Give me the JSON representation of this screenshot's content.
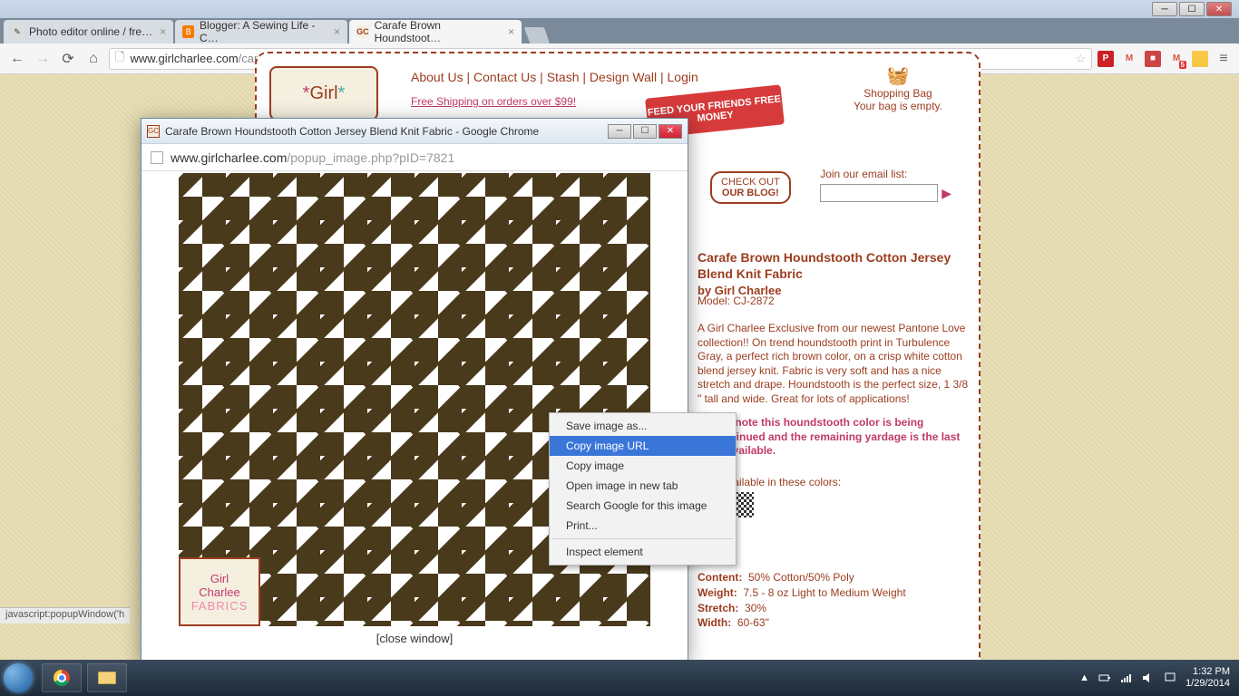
{
  "window": {
    "minimize": "─",
    "maximize": "☐",
    "close": "✕"
  },
  "tabs": [
    {
      "title": "Photo editor online / fre…"
    },
    {
      "title": "Blogger: A Sewing Life - C…"
    },
    {
      "title": "Carafe Brown Houndstoot…"
    }
  ],
  "omnibox": {
    "host": "www.girlcharlee.com",
    "path": "/carafe-brown-houndstooth-cotton-jersey-blend-knit-fabric/girl-charlee-p-7821.html?cPath=149"
  },
  "ext": {
    "pinterest": "P",
    "gmail": "M",
    "wall": "■",
    "gmail2": "M",
    "badge": "5",
    "menu": "≡"
  },
  "nav": {
    "about": "About Us",
    "contact": "Contact Us",
    "stash": "Stash",
    "design": "Design Wall",
    "login": "Login",
    "sep": " | "
  },
  "logo": "Girl",
  "shipping": "Free Shipping on orders over $99!",
  "ribbon": "FEED YOUR FRIENDS FREE MONEY",
  "bag": {
    "icon": "🧺",
    "label": "Shopping Bag",
    "empty": "Your bag is empty."
  },
  "blog": {
    "line1": "CHECK OUT",
    "line2": "OUR BLOG!"
  },
  "email": {
    "label": "Join our email list:",
    "arrow": "▶"
  },
  "product": {
    "title": "Carafe Brown Houndstooth Cotton Jersey Blend Knit Fabric",
    "by": "by Girl Charlee",
    "model": "Model: CJ-2872",
    "desc": "A Girl Charlee Exclusive from our newest Pantone Love collection!! On trend houndstooth print in Turbulence Gray, a perfect rich brown color, on a crisp white cotton blend jersey knit. Fabric is very soft and has a nice stretch and drape. Houndstooth is the perfect size, 1 3/8 \" tall and wide. Great for lots of applications!",
    "note": "Please note this houndstooth color is being discontinued and the remaining yardage is the last to be available.",
    "avail": "Also available in these colors:",
    "content_l": "Content:",
    "content_v": "50% Cotton/50% Poly",
    "weight_l": "Weight:",
    "weight_v": "7.5 - 8 oz Light to Medium Weight",
    "stretch_l": "Stretch:",
    "stretch_v": "30%",
    "width_l": "Width:",
    "width_v": "60-63\""
  },
  "popup": {
    "title": "Carafe Brown Houndstooth Cotton Jersey Blend Knit Fabric - Google Chrome",
    "min": "─",
    "max": "☐",
    "close": "✕",
    "host": "www.girlcharlee.com",
    "path": "/popup_image.php?pID=7821",
    "logo1": "Girl",
    "logo2": "Charlee",
    "logo3": "FABRICS",
    "closewin": "[close window]"
  },
  "ctx": {
    "save": "Save image as...",
    "copyurl": "Copy image URL",
    "copyimg": "Copy image",
    "opennew": "Open image in new tab",
    "search": "Search Google for this image",
    "print": "Print...",
    "inspect": "Inspect element"
  },
  "status": "javascript:popupWindow('h",
  "tray": {
    "up": "▲",
    "time": "1:32 PM",
    "date": "1/29/2014"
  }
}
